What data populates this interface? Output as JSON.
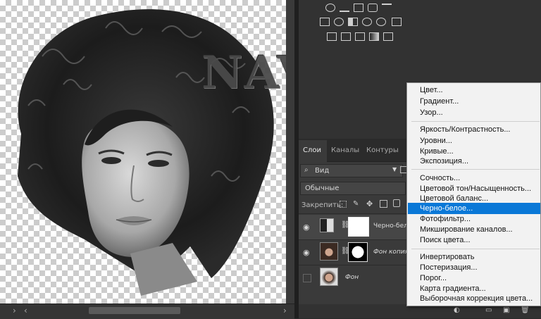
{
  "layers_panel": {
    "tabs": [
      "Слои",
      "Каналы",
      "Контуры"
    ],
    "filter_value": "Вид",
    "blend_mode": "Обычные",
    "lock_label": "Закрепить:",
    "layers": [
      {
        "name": "Черно-белое",
        "visible": true
      },
      {
        "name": "Фон копия",
        "visible": true
      },
      {
        "name": "Фон",
        "visible": false
      }
    ]
  },
  "canvas": {
    "watermark_text": "NAVI"
  },
  "adjustments_menu": {
    "groups": [
      [
        "Цвет...",
        "Градиент...",
        "Узор..."
      ],
      [
        "Яркость/Контрастность...",
        "Уровни...",
        "Кривые...",
        "Экспозиция..."
      ],
      [
        "Сочность...",
        "Цветовой тон/Насыщенность...",
        "Цветовой баланс...",
        "Черно-белое...",
        "Фотофильтр...",
        "Микширование каналов...",
        "Поиск цвета..."
      ],
      [
        "Инвертировать",
        "Постеризация...",
        "Порог...",
        "Карта градиента...",
        "Выборочная коррекция цвета..."
      ]
    ],
    "selected": "Черно-белое..."
  },
  "colors": {
    "highlight": "#0a78d7",
    "panel": "#323232",
    "menu_bg": "#f2f2f2"
  }
}
